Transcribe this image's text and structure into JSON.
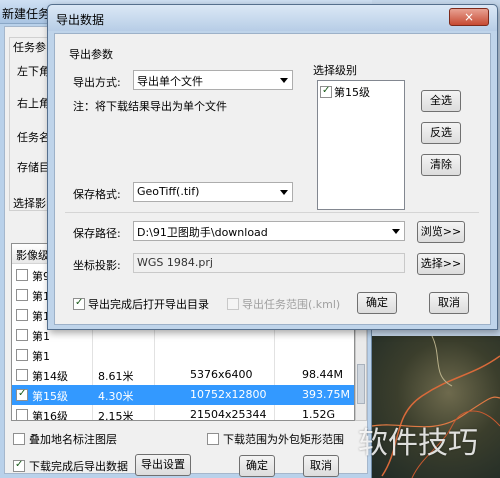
{
  "bg_window": {
    "title": "新建任务",
    "labels": {
      "task_params": "任务参",
      "top_left": "左下角",
      "top_right": "右上角",
      "task_name": "任务名",
      "store_dir": "存储目",
      "select_level": "选择影"
    },
    "list": {
      "header": "影像级",
      "rows": [
        {
          "level": "第9",
          "checked": false,
          "selected": false,
          "res": "",
          "size": "",
          "data": ""
        },
        {
          "level": "第1",
          "checked": false,
          "selected": false,
          "res": "",
          "size": "",
          "data": ""
        },
        {
          "level": "第1",
          "checked": false,
          "selected": false,
          "res": "",
          "size": "",
          "data": ""
        },
        {
          "level": "第1",
          "checked": false,
          "selected": false,
          "res": "",
          "size": "",
          "data": ""
        },
        {
          "level": "第1",
          "checked": false,
          "selected": false,
          "res": "",
          "size": "",
          "data": ""
        },
        {
          "level": "第14级",
          "checked": false,
          "selected": false,
          "res": "8.61米",
          "size": "5376x6400",
          "data": "98.44M"
        },
        {
          "level": "第15级",
          "checked": true,
          "selected": true,
          "res": "4.30米",
          "size": "10752x12800",
          "data": "393.75M"
        },
        {
          "level": "第16级",
          "checked": false,
          "selected": false,
          "res": "2.15米",
          "size": "21504x25344",
          "data": "1.52G"
        }
      ]
    },
    "overlay_label": "叠加地名标注图层",
    "bbox_label": "下载范围为外包矩形范围",
    "export_after_label": "下载完成后导出数据",
    "export_settings_button": "导出设置",
    "ok_button": "确定",
    "cancel_button": "取消"
  },
  "dialog": {
    "title": "导出数据",
    "close_icon": "×",
    "group_label": "导出参数",
    "export_mode_label": "导出方式:",
    "export_mode_value": "导出单个文件",
    "note": "注：将下载结果导出为单个文件",
    "format_label": "保存格式:",
    "format_value": "GeoTiff(.tif)",
    "path_label": "保存路径:",
    "path_value": "D:\\91卫图助手\\download",
    "browse_button": "浏览>>",
    "coord_label": "坐标投影:",
    "coord_value": "WGS 1984.prj",
    "select_button": "选择>>",
    "level_group_label": "选择级别",
    "levels": [
      {
        "label": "第15级",
        "checked": true
      }
    ],
    "select_all_button": "全选",
    "invert_button": "反选",
    "clear_button": "清除",
    "open_dir_label": "导出完成后打开导出目录",
    "open_dir_checked": true,
    "export_range_label": "导出任务范围(.kml)",
    "export_range_checked": false,
    "ok_button": "确定",
    "cancel_button": "取消"
  },
  "watermark": "软件技巧",
  "colors": {
    "selection": "#3399ff",
    "dialog_frame": "#bfd4ea",
    "close_button": "#c74a32"
  }
}
